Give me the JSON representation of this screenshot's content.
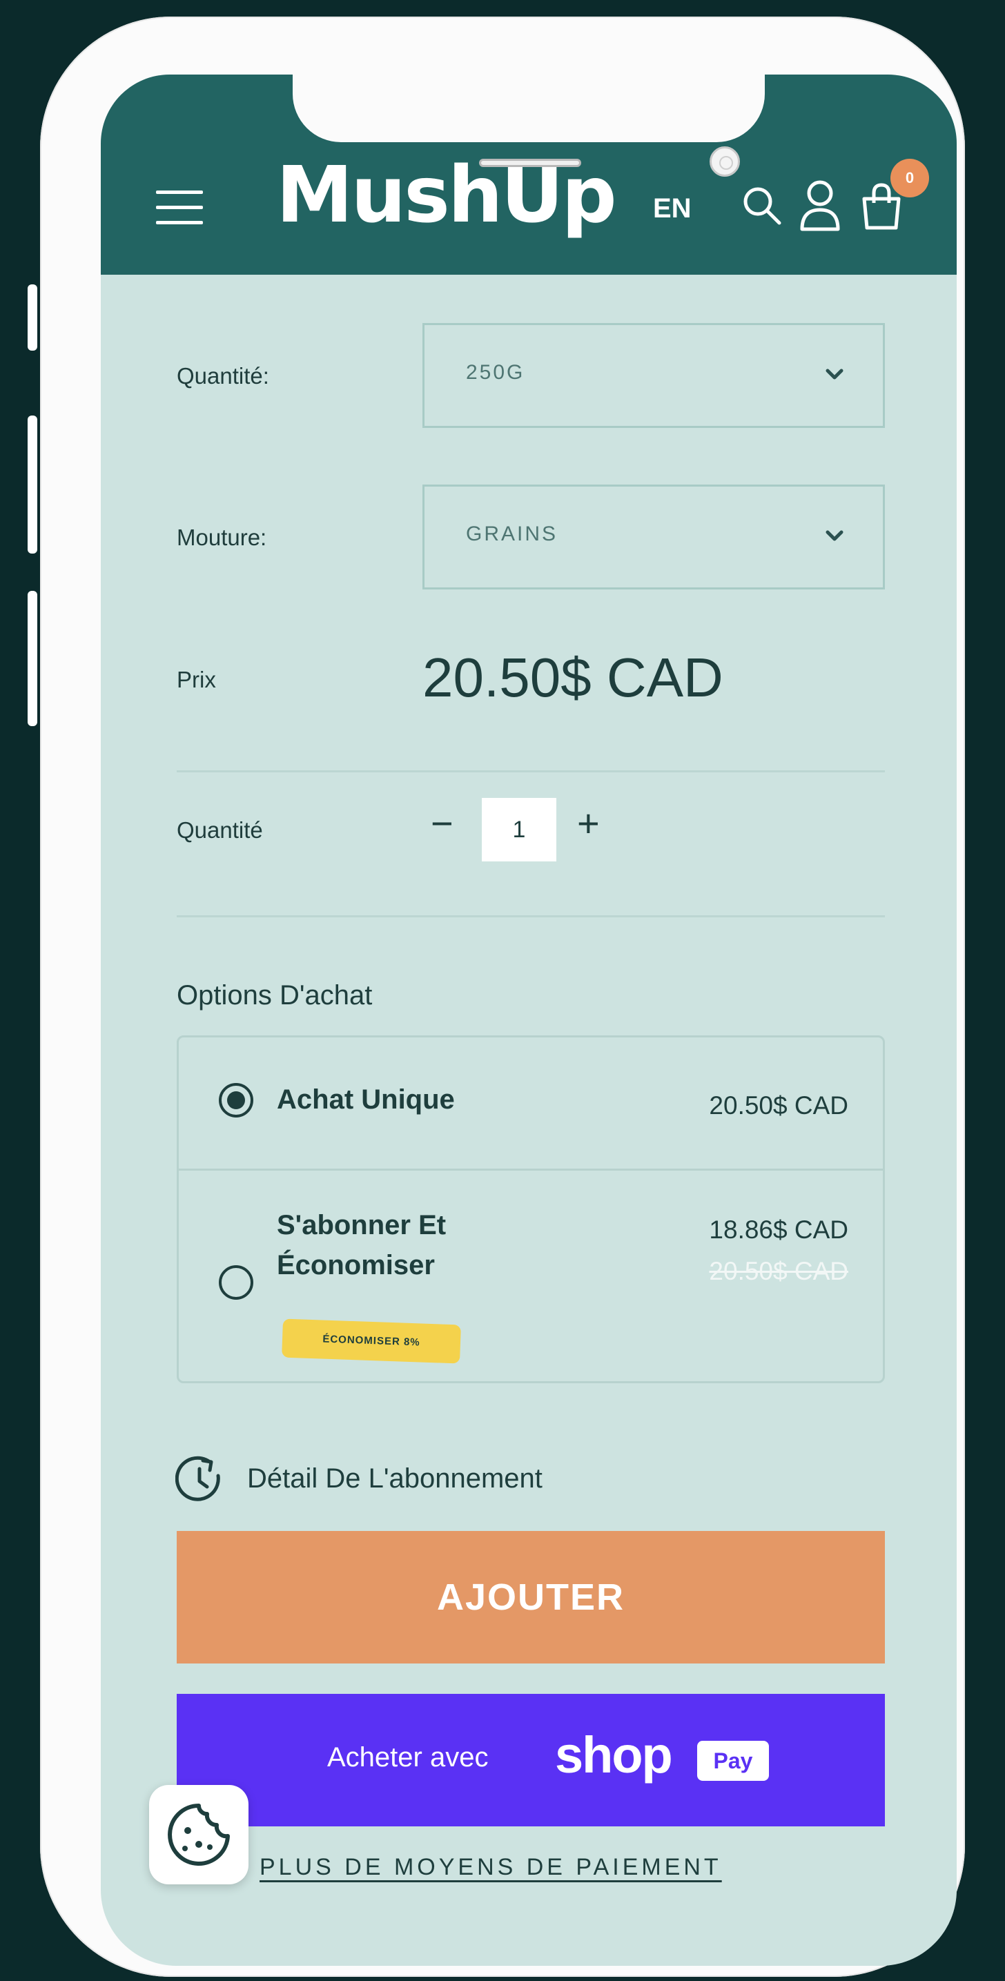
{
  "header": {
    "logo": "MushUp",
    "language": "EN",
    "cart_count": "0",
    "icons": [
      "menu-icon",
      "search-icon",
      "account-icon",
      "cart-icon"
    ]
  },
  "variants": {
    "quantity_label": "Quantité:",
    "quantity_value": "250G",
    "grind_label": "Mouture:",
    "grind_value": "GRAINS"
  },
  "price": {
    "label": "Prix",
    "value": "20.50$ CAD"
  },
  "quantity": {
    "label": "Quantité",
    "minus": "−",
    "value": "1",
    "plus": "+"
  },
  "purchase_options": {
    "title": "Options D'achat",
    "one_time": {
      "label": "Achat Unique",
      "price": "20.50$ CAD",
      "selected": true
    },
    "subscribe": {
      "label_line1": "S'abonner Et",
      "label_line2": "Économiser",
      "badge": "ÉCONOMISER 8%",
      "price": "18.86$ CAD",
      "original_price": "20.50$ CAD",
      "selected": false
    },
    "detail_link": "Détail De L'abonnement"
  },
  "actions": {
    "add_to_cart": "AJOUTER",
    "shop_pay_prefix": "Acheter avec",
    "shop_pay_brand": "shop",
    "shop_pay_tag": "Pay",
    "more_payment": "PLUS DE MOYENS DE PAIEMENT"
  },
  "colors": {
    "header": "#226462",
    "background": "#cde3e0",
    "add_button": "#e49866",
    "shop_pay": "#5a31f4",
    "badge": "#f4d24c",
    "cart_badge": "#e9905a"
  }
}
